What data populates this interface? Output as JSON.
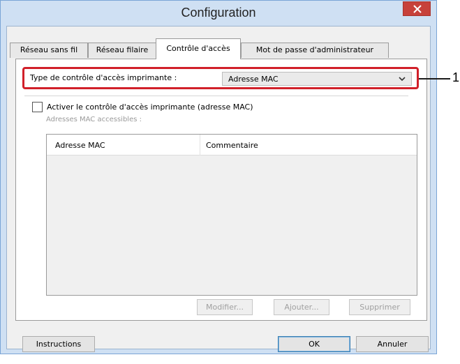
{
  "window": {
    "title": "Configuration",
    "close_label": "×"
  },
  "tabs": [
    {
      "label": "Réseau sans fil",
      "active": false
    },
    {
      "label": "Réseau filaire",
      "active": false
    },
    {
      "label": "Contrôle d'accès",
      "active": true
    },
    {
      "label": "Mot de passe d'administrateur",
      "active": false
    }
  ],
  "access_control": {
    "type_label": "Type de contrôle d'accès imprimante :",
    "type_value": "Adresse MAC",
    "callout": "1",
    "enable_label": "Activer le contrôle d'accès imprimante (adresse MAC)",
    "enable_checked": false,
    "accessible_label": "Adresses MAC accessibles :",
    "columns": [
      "Adresse MAC",
      "Commentaire"
    ],
    "rows": []
  },
  "buttons": {
    "modify": "Modifier...",
    "add": "Ajouter...",
    "delete": "Supprimer",
    "instructions": "Instructions",
    "ok": "OK",
    "cancel": "Annuler"
  },
  "colors": {
    "highlight": "#d1202a",
    "close": "#c7413a",
    "frame": "#cfe0f3"
  }
}
